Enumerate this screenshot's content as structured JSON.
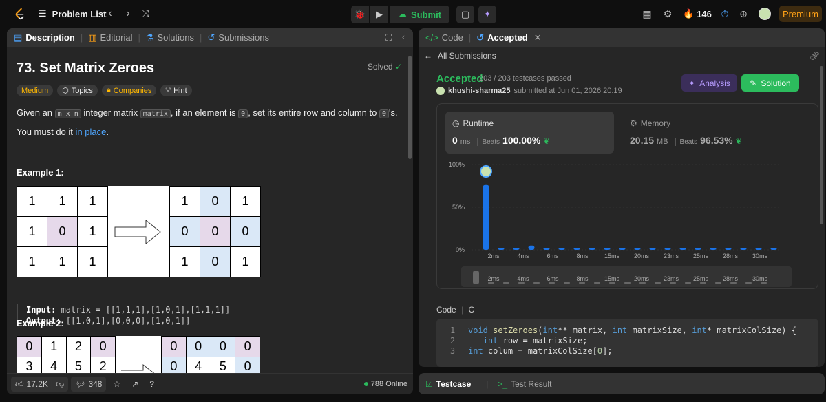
{
  "topbar": {
    "problem_list": "Problem List",
    "submit": "Submit",
    "streak": "146",
    "premium": "Premium",
    "accent": "#ffa116"
  },
  "left": {
    "tabs": [
      "Description",
      "Editorial",
      "Solutions",
      "Submissions"
    ],
    "title": "73. Set Matrix Zeroes",
    "solved": "Solved",
    "chips": [
      "Medium",
      "Topics",
      "Companies",
      "Hint"
    ],
    "p1": {
      "a": "Given an ",
      "c1": "m x n",
      "b": " integer matrix ",
      "c2": "matrix",
      "c": ", if an element is ",
      "c3": "0",
      "d": ", set its entire row and column to ",
      "c4": "0",
      "e": "'s."
    },
    "p2": {
      "a": "You must do it ",
      "link": "in place",
      "b": "."
    },
    "example1": "Example 1:",
    "example2": "Example 2:",
    "grid1_in": [
      "1",
      "1",
      "1",
      "1",
      "0",
      "1",
      "1",
      "1",
      "1"
    ],
    "grid1_out": [
      "1",
      "0",
      "1",
      "0",
      "0",
      "0",
      "1",
      "0",
      "1"
    ],
    "grid2_in": [
      "0",
      "1",
      "2",
      "0",
      "3",
      "4",
      "5",
      "2"
    ],
    "grid2_out": [
      "0",
      "0",
      "0",
      "0",
      "0",
      "4",
      "5",
      "0"
    ],
    "input_label": "Input:",
    "input_val": " matrix = [[1,1,1],[1,0,1],[1,1,1]]",
    "output_label": "Output:",
    "output_val": " [[1,0,1],[0,0,0],[1,0,1]]",
    "likes": "17.2K",
    "comments": "348",
    "online": "788 Online"
  },
  "right": {
    "tabs": [
      "Code",
      "Accepted"
    ],
    "all_submissions": "All Submissions",
    "status": "Accepted",
    "passed": "203 / 203 testcases passed",
    "user": "khushi-sharma25",
    "submitted": "submitted at Jun 01, 2026 20:19",
    "analysis": "Analysis",
    "solution": "Solution",
    "runtime": {
      "label": "Runtime",
      "value": "0",
      "unit": "ms",
      "beats_label": "Beats",
      "beats": "100.00%"
    },
    "memory": {
      "label": "Memory",
      "value": "20.15",
      "unit": "MB",
      "beats_label": "Beats",
      "beats": "96.53%"
    },
    "code_label": "Code",
    "lang": "C",
    "code_lines": [
      {
        "n": "1",
        "t": "void setZeroes(int** matrix, int matrixSize, int* matrixColSize) {"
      },
      {
        "n": "2",
        "t": "   int row = matrixSize;"
      },
      {
        "n": "3",
        "t": "int colum = matrixColSize[0];"
      }
    ],
    "bottom_tabs": [
      "Testcase",
      "Test Result"
    ]
  },
  "chart_data": {
    "type": "bar",
    "yticks": [
      "100%",
      "50%",
      "0%"
    ],
    "xticks": [
      "2ms",
      "4ms",
      "6ms",
      "8ms",
      "15ms",
      "20ms",
      "23ms",
      "25ms",
      "28ms",
      "30ms"
    ],
    "values": [
      76,
      2,
      2,
      5,
      2,
      2,
      2,
      2,
      2,
      2,
      2,
      2,
      2,
      2,
      2,
      2,
      2,
      2,
      2,
      2
    ],
    "ylim": [
      0,
      100
    ],
    "highlight_color": "#1a73e8"
  }
}
